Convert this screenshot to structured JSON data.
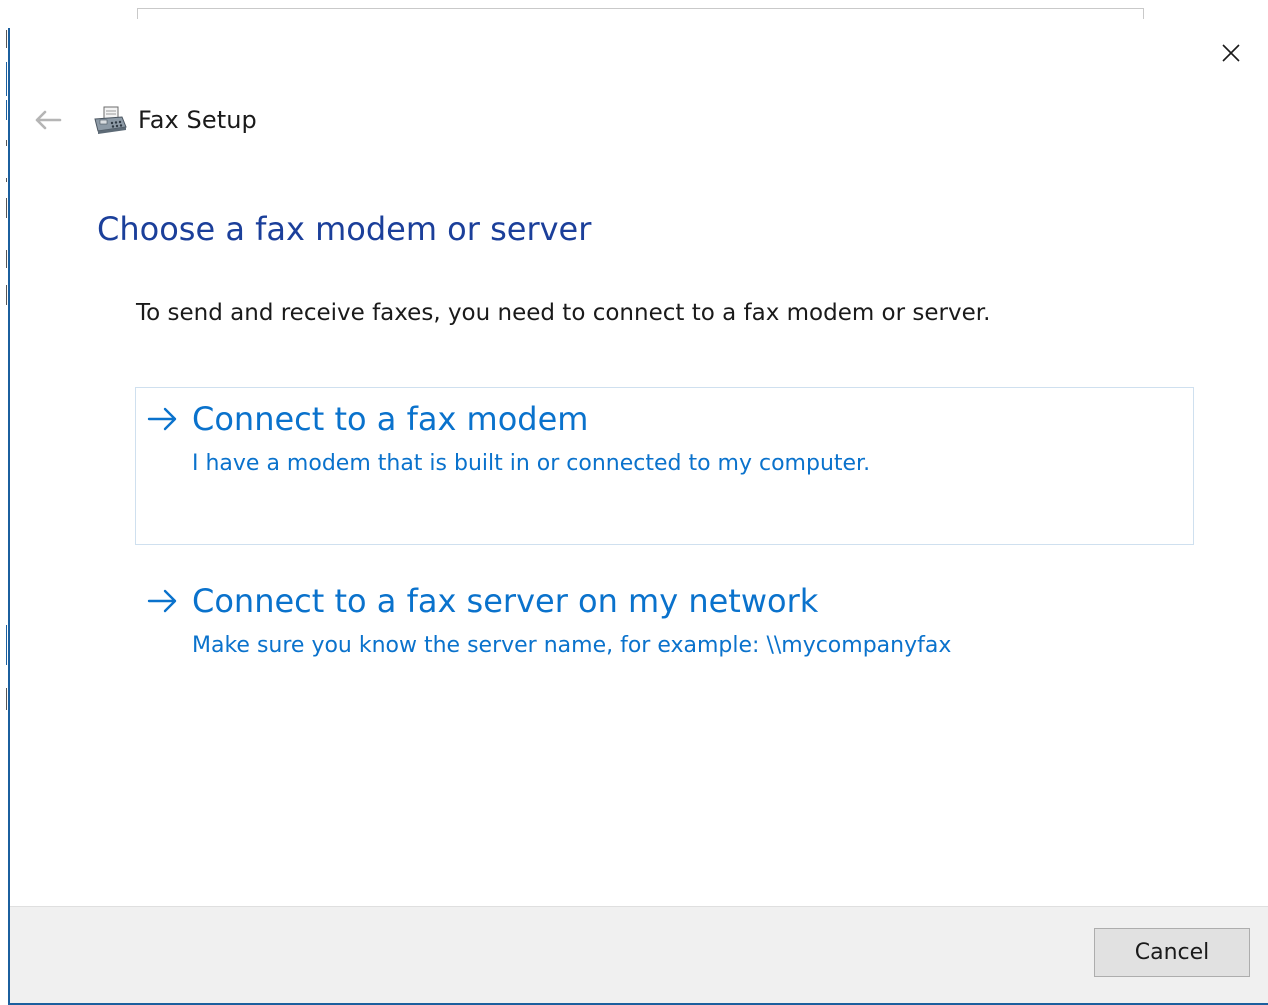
{
  "window": {
    "title": "Fax Setup",
    "close_icon": "close-icon",
    "back_icon": "back-arrow-icon",
    "app_icon": "fax-machine-icon"
  },
  "page": {
    "heading": "Choose a fax modem or server",
    "intro": "To send and receive faxes, you need to connect to a fax modem or server."
  },
  "options": [
    {
      "title": "Connect to a fax modem",
      "description": "I have a modem that is built in or connected to my computer.",
      "icon": "arrow-right-icon"
    },
    {
      "title": "Connect to a fax server on my network",
      "description": "Make sure you know the server name, for example: \\\\mycompanyfax",
      "icon": "arrow-right-icon"
    }
  ],
  "footer": {
    "cancel_label": "Cancel"
  },
  "colors": {
    "heading": "#1b3f9a",
    "link": "#0a72cc",
    "footer_bg": "#f0f0f0",
    "focus_border": "#cfe0ef"
  }
}
